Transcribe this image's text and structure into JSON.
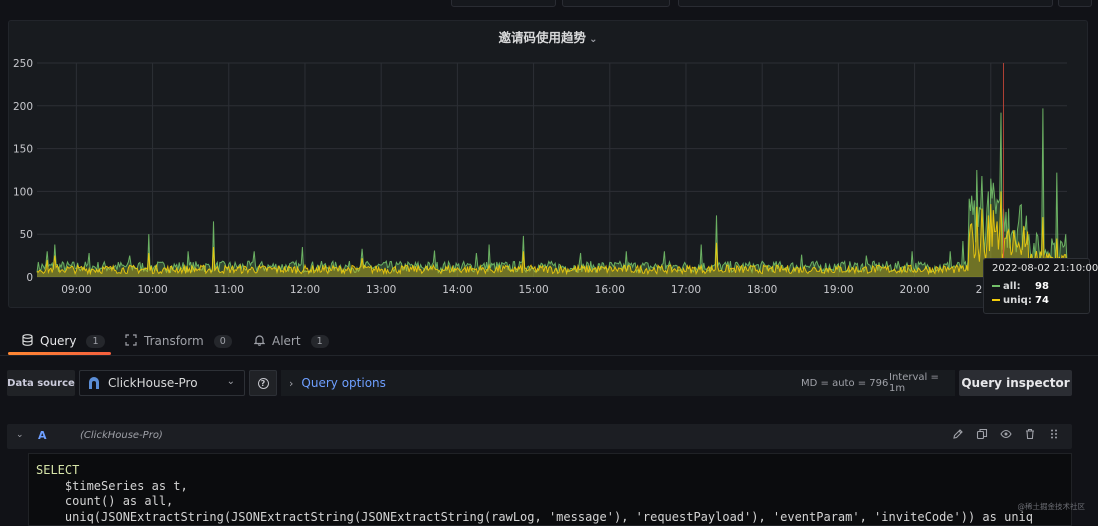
{
  "panel": {
    "title": "邀请码使用趋势"
  },
  "chart_data": {
    "type": "area",
    "title": "邀请码使用趋势",
    "x_ticks": [
      "09:00",
      "10:00",
      "11:00",
      "12:00",
      "13:00",
      "14:00",
      "15:00",
      "16:00",
      "17:00",
      "18:00",
      "19:00",
      "20:00",
      "21:00"
    ],
    "x_range": [
      "08:29",
      "22:00"
    ],
    "y_ticks": [
      "0",
      "50",
      "100",
      "150",
      "200",
      "250"
    ],
    "ylim": [
      0,
      250
    ],
    "grid": true,
    "cursor_time": "21:10",
    "series": [
      {
        "name": "all",
        "color": "#73bf69",
        "baseline": 12,
        "spikes": [
          [
            "08:37",
            30
          ],
          [
            "08:43",
            38
          ],
          [
            "09:10",
            28
          ],
          [
            "09:42",
            25
          ],
          [
            "09:57",
            50
          ],
          [
            "10:28",
            30
          ],
          [
            "10:48",
            65
          ],
          [
            "11:20",
            30
          ],
          [
            "11:58",
            35
          ],
          [
            "12:45",
            33
          ],
          [
            "13:42",
            31
          ],
          [
            "14:15",
            28
          ],
          [
            "14:25",
            38
          ],
          [
            "14:52",
            48
          ],
          [
            "15:37",
            28
          ],
          [
            "16:13",
            30
          ],
          [
            "16:43",
            30
          ],
          [
            "17:12",
            38
          ],
          [
            "17:24",
            72
          ],
          [
            "18:31",
            26
          ],
          [
            "19:22",
            25
          ],
          [
            "19:58",
            30
          ],
          [
            "20:28",
            30
          ],
          [
            "20:38",
            42
          ],
          [
            "20:45",
            95
          ],
          [
            "20:49",
            125
          ],
          [
            "20:53",
            118
          ],
          [
            "20:58",
            100
          ],
          [
            "21:00",
            115
          ],
          [
            "21:02",
            110
          ],
          [
            "21:05",
            90
          ],
          [
            "21:08",
            192
          ],
          [
            "21:14",
            80
          ],
          [
            "21:22",
            65
          ],
          [
            "21:27",
            55
          ],
          [
            "21:30",
            50
          ],
          [
            "21:38",
            30
          ],
          [
            "21:41",
            197
          ],
          [
            "21:48",
            45
          ],
          [
            "21:52",
            122
          ],
          [
            "21:57",
            35
          ]
        ]
      },
      {
        "name": "uniq",
        "color": "#f2cc0c",
        "baseline": 9,
        "spikes": [
          [
            "08:37",
            20
          ],
          [
            "08:43",
            25
          ],
          [
            "09:57",
            28
          ],
          [
            "10:48",
            35
          ],
          [
            "12:45",
            22
          ],
          [
            "14:52",
            30
          ],
          [
            "17:24",
            40
          ],
          [
            "20:45",
            62
          ],
          [
            "20:49",
            82
          ],
          [
            "20:53",
            80
          ],
          [
            "20:58",
            72
          ],
          [
            "21:00",
            85
          ],
          [
            "21:02",
            78
          ],
          [
            "21:05",
            65
          ],
          [
            "21:08",
            100
          ],
          [
            "21:14",
            55
          ],
          [
            "21:22",
            40
          ],
          [
            "21:27",
            35
          ],
          [
            "21:41",
            70
          ],
          [
            "21:52",
            45
          ]
        ]
      }
    ]
  },
  "tooltip": {
    "time": "2022-08-02 21:10:00",
    "rows": [
      {
        "label": "all:",
        "value": "98",
        "color": "#73bf69"
      },
      {
        "label": "uniq:",
        "value": "74",
        "color": "#f2cc0c"
      }
    ]
  },
  "tabs": [
    {
      "label": "Query",
      "count": "1",
      "icon": "database-icon"
    },
    {
      "label": "Transform",
      "count": "0",
      "icon": "transform-icon"
    },
    {
      "label": "Alert",
      "count": "1",
      "icon": "bell-icon"
    }
  ],
  "datasource": {
    "label": "Data source",
    "selected": "ClickHouse-Pro"
  },
  "query_options": {
    "label": "Query options",
    "md": "MD = auto = 796",
    "interval": "Interval = 1m"
  },
  "query_inspector": {
    "label": "Query inspector"
  },
  "query": {
    "ref": "A",
    "datasource": "(ClickHouse-Pro)",
    "lines": [
      "SELECT",
      "    $timeSeries as t,",
      "    count() as all,",
      "    uniq(JSONExtractString(JSONExtractString(JSONExtractString(rawLog, 'message'), 'requestPayload'), 'eventParam', 'inviteCode')) as uniq"
    ]
  },
  "watermark": "@稀土掘金技术社区"
}
